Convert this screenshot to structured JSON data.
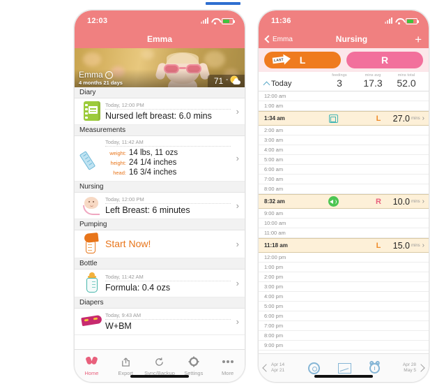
{
  "progress_indicator": {
    "name": "page-scroll-indicator"
  },
  "left_phone": {
    "status": {
      "time": "12:03"
    },
    "navbar": {
      "title": "Emma"
    },
    "hero": {
      "baby_name": "Emma",
      "baby_age": "4 months 21 days",
      "temperature": "71",
      "degree": "°"
    },
    "sections": [
      {
        "header": "Diary",
        "icon": "journal-icon",
        "time": "Today, 12:00 PM",
        "main": "Nursed left breast: 6.0 mins",
        "accent": false
      },
      {
        "header": "Measurements",
        "icon": "ruler-icon",
        "time": "Today, 11:42 AM",
        "measurements": [
          {
            "label": "weight:",
            "value": "14 lbs, 11 ozs"
          },
          {
            "label": "height:",
            "value": "24 1/4 inches"
          },
          {
            "label": "head:",
            "value": "16 3/4 inches"
          }
        ]
      },
      {
        "header": "Nursing",
        "icon": "baby-face-icon",
        "time": "Today, 12:00 PM",
        "main": "Left Breast: 6 minutes",
        "accent": false
      },
      {
        "header": "Pumping",
        "icon": "breast-pump-icon",
        "time": "",
        "main": "Start Now!",
        "accent": true
      },
      {
        "header": "Bottle",
        "icon": "baby-bottle-icon",
        "time": "Today, 11:42 AM",
        "main": "Formula: 0.4 ozs",
        "accent": false
      },
      {
        "header": "Diapers",
        "icon": "diaper-icon",
        "time": "Today, 9:43 AM",
        "main": "W+BM",
        "accent": false
      }
    ],
    "chevron": "›",
    "tabs": [
      {
        "label": "Home",
        "icon": "footprints-icon",
        "active": true
      },
      {
        "label": "Export",
        "icon": "share-icon",
        "active": false
      },
      {
        "label": "Sync/Backup",
        "icon": "refresh-icon",
        "active": false
      },
      {
        "label": "Settings",
        "icon": "gear-icon",
        "active": false
      },
      {
        "label": "More",
        "icon": "ellipsis-icon",
        "active": false
      }
    ]
  },
  "right_phone": {
    "status": {
      "time": "11:36"
    },
    "navbar": {
      "back_label": "Emma",
      "title": "Nursing",
      "add_label": "+"
    },
    "side_buttons": [
      {
        "label": "L",
        "side": "l",
        "badge": "LAST"
      },
      {
        "label": "R",
        "side": "r",
        "badge": ""
      }
    ],
    "stats": {
      "day_label": "Today",
      "items": [
        {
          "key": "feedings",
          "value": "3"
        },
        {
          "key": "mins avg",
          "value": "17.3"
        },
        {
          "key": "mins total",
          "value": "52.0"
        }
      ]
    },
    "timeline": [
      {
        "time": "12:00 am",
        "entry": false
      },
      {
        "time": "1:00 am",
        "entry": false
      },
      {
        "time": "1:34 am",
        "entry": true,
        "icon": "note-icon",
        "side": "L",
        "duration": "27.0",
        "unit": "mins"
      },
      {
        "time": "2:00 am",
        "entry": false
      },
      {
        "time": "3:00 am",
        "entry": false
      },
      {
        "time": "4:00 am",
        "entry": false
      },
      {
        "time": "5:00 am",
        "entry": false
      },
      {
        "time": "6:00 am",
        "entry": false
      },
      {
        "time": "7:00 am",
        "entry": false
      },
      {
        "time": "8:00 am",
        "entry": false
      },
      {
        "time": "8:32 am",
        "entry": true,
        "icon": "sound-icon",
        "side": "R",
        "duration": "10.0",
        "unit": "mins"
      },
      {
        "time": "9:00 am",
        "entry": false
      },
      {
        "time": "10:00 am",
        "entry": false
      },
      {
        "time": "11:00 am",
        "entry": false
      },
      {
        "time": "11:18 am",
        "entry": true,
        "icon": "",
        "side": "L",
        "duration": "15.0",
        "unit": "mins"
      },
      {
        "time": "12:00 pm",
        "entry": false
      },
      {
        "time": "1:00 pm",
        "entry": false
      },
      {
        "time": "2:00 pm",
        "entry": false
      },
      {
        "time": "3:00 pm",
        "entry": false
      },
      {
        "time": "4:00 pm",
        "entry": false
      },
      {
        "time": "5:00 pm",
        "entry": false
      },
      {
        "time": "6:00 pm",
        "entry": false
      },
      {
        "time": "7:00 pm",
        "entry": false
      },
      {
        "time": "8:00 pm",
        "entry": false
      },
      {
        "time": "9:00 pm",
        "entry": false
      }
    ],
    "chevron": "›",
    "bottombar": {
      "prev": {
        "line1": "Apr 14",
        "line2": "Apr 21"
      },
      "next": {
        "line1": "Apr 28",
        "line2": "May 5"
      },
      "icons": [
        "gear-icon",
        "chart-icon",
        "alarm-clock-icon"
      ]
    }
  },
  "colors": {
    "header_pink": "#f08080",
    "accent_orange": "#e8751a",
    "button_left": "#ef7b1f",
    "button_right": "#f2709c",
    "entry_row": "#fdf0d8",
    "active_tab": "#e8607c",
    "progress_blue": "#2f6fd0"
  }
}
